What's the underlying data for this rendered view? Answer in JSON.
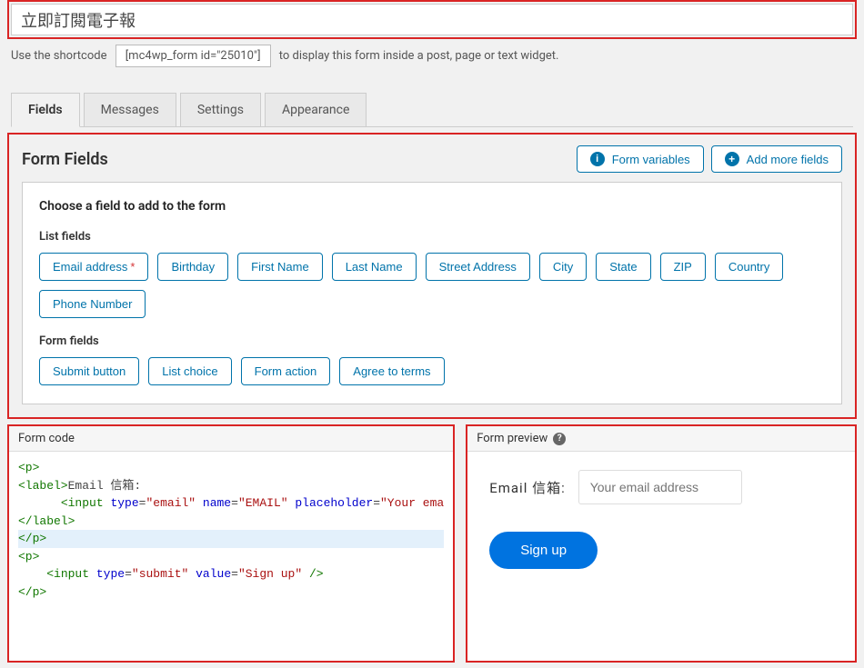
{
  "titleInput": "立即訂閱電子報",
  "shortcodeRow": {
    "prefix": "Use the shortcode",
    "code": "[mc4wp_form id=\"25010\"]",
    "suffix": "to display this form inside a post, page or text widget."
  },
  "tabs": {
    "active": "Fields",
    "items": [
      "Fields",
      "Messages",
      "Settings",
      "Appearance"
    ]
  },
  "formFields": {
    "heading": "Form Fields",
    "btnVariables": "Form variables",
    "btnAddMore": "Add more fields",
    "chooseTitle": "Choose a field to add to the form",
    "listFieldsLabel": "List fields",
    "listFields": [
      {
        "label": "Email address",
        "required": true
      },
      {
        "label": "Birthday"
      },
      {
        "label": "First Name"
      },
      {
        "label": "Last Name"
      },
      {
        "label": "Street Address"
      },
      {
        "label": "City"
      },
      {
        "label": "State"
      },
      {
        "label": "ZIP"
      },
      {
        "label": "Country"
      },
      {
        "label": "Phone Number"
      }
    ],
    "formFieldsLabel": "Form fields",
    "formFieldButtons": [
      "Submit button",
      "List choice",
      "Form action",
      "Agree to terms"
    ]
  },
  "formCode": {
    "heading": "Form code",
    "lines": [
      {
        "html": "<span class='tag-br'>&lt;p&gt;</span>"
      },
      {
        "html": "<span class='tag-br'>&lt;label&gt;</span>Email 信箱: "
      },
      {
        "html": "      <span class='tag-br'>&lt;</span><span class='tag-name'>input</span> <span class='attr-name'>type</span>=<span class='attr-val'>\"email\"</span> <span class='attr-name'>name</span>=<span class='attr-val'>\"EMAIL\"</span> <span class='attr-name'>placeholder</span>=<span class='attr-val'>\"Your ema</span>"
      },
      {
        "html": "<span class='tag-br'>&lt;/label&gt;</span>"
      },
      {
        "html": "<span class='tag-br'>&lt;/p&gt;</span>",
        "hl": true
      },
      {
        "html": "<span class='tag-br'>&lt;p&gt;</span>"
      },
      {
        "html": "    <span class='tag-br'>&lt;</span><span class='tag-name'>input</span> <span class='attr-name'>type</span>=<span class='attr-val'>\"submit\"</span> <span class='attr-name'>value</span>=<span class='attr-val'>\"Sign up\"</span> <span class='tag-br'>/&gt;</span>"
      },
      {
        "html": "<span class='tag-br'>&lt;/p&gt;</span>"
      }
    ]
  },
  "formPreview": {
    "heading": "Form preview",
    "label": "Email 信箱:",
    "placeholder": "Your email address",
    "submit": "Sign up"
  }
}
